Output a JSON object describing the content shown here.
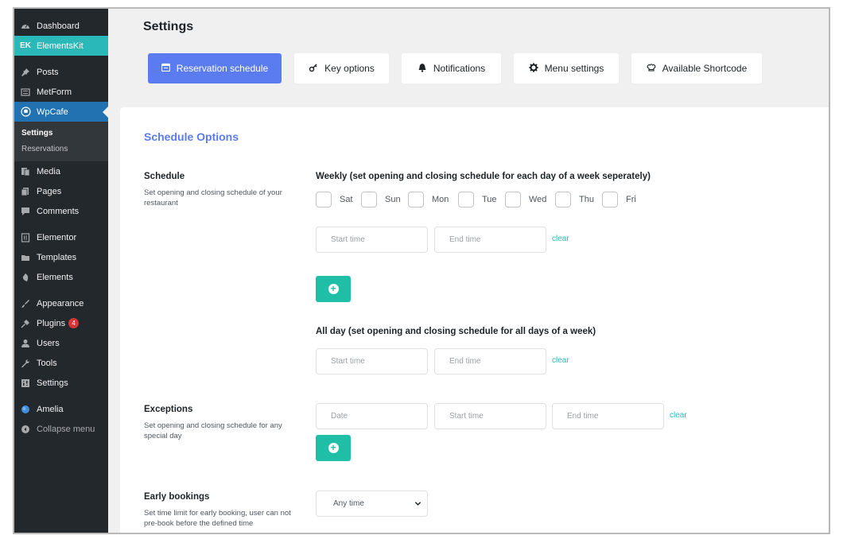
{
  "sidebar": {
    "items": [
      {
        "label": "Dashboard",
        "icon": "dashboard-icon"
      },
      {
        "label": "ElementsKit",
        "icon": "elementskit-icon"
      },
      {
        "label": "Posts",
        "icon": "pin-icon"
      },
      {
        "label": "MetForm",
        "icon": "form-icon"
      },
      {
        "label": "WpCafe",
        "icon": "cafe-icon"
      },
      {
        "label": "Media",
        "icon": "media-icon"
      },
      {
        "label": "Pages",
        "icon": "pages-icon"
      },
      {
        "label": "Comments",
        "icon": "comments-icon"
      },
      {
        "label": "Elementor",
        "icon": "elementor-icon"
      },
      {
        "label": "Templates",
        "icon": "folder-icon"
      },
      {
        "label": "Elements",
        "icon": "elements-icon"
      },
      {
        "label": "Appearance",
        "icon": "brush-icon"
      },
      {
        "label": "Plugins",
        "icon": "plugin-icon",
        "badge": "4"
      },
      {
        "label": "Users",
        "icon": "user-icon"
      },
      {
        "label": "Tools",
        "icon": "wrench-icon"
      },
      {
        "label": "Settings",
        "icon": "settings-icon"
      },
      {
        "label": "Amelia",
        "icon": "amelia-icon"
      },
      {
        "label": "Collapse menu",
        "icon": "collapse-icon"
      }
    ],
    "submenu": [
      "Settings",
      "Reservations"
    ]
  },
  "header": {
    "title": "Settings",
    "tabs": [
      {
        "label": "Reservation schedule",
        "icon": "calendar-icon"
      },
      {
        "label": "Key options",
        "icon": "key-icon"
      },
      {
        "label": "Notifications",
        "icon": "bell-icon"
      },
      {
        "label": "Menu settings",
        "icon": "gear-icon"
      },
      {
        "label": "Available Shortcode",
        "icon": "chef-hat-icon"
      }
    ]
  },
  "panel": {
    "section_title": "Schedule Options",
    "schedule": {
      "label": "Schedule",
      "desc": "Set opening and closing schedule of your restaurant",
      "weekly_head": "Weekly (set opening and closing schedule for each day of a week seperately)",
      "days": [
        "Sat",
        "Sun",
        "Mon",
        "Tue",
        "Wed",
        "Thu",
        "Fri"
      ],
      "start_placeholder": "Start time",
      "end_placeholder": "End time",
      "clear": "clear",
      "allday_head": "All day (set opening and closing schedule for all days of a week)"
    },
    "exceptions": {
      "label": "Exceptions",
      "desc": "Set opening and closing schedule for any special day",
      "date_placeholder": "Date",
      "start_placeholder": "Start time",
      "end_placeholder": "End time",
      "clear": "clear"
    },
    "early": {
      "label": "Early bookings",
      "desc": "Set time limit for early booking, user can not pre-book before the defined time",
      "select_value": "Any time"
    }
  },
  "colors": {
    "accent": "#5b7cf0",
    "teal": "#1fbfa7",
    "sidebar_bg": "#23282d",
    "active_menu": "#2271b1",
    "elementskit": "#2ab8b8"
  }
}
